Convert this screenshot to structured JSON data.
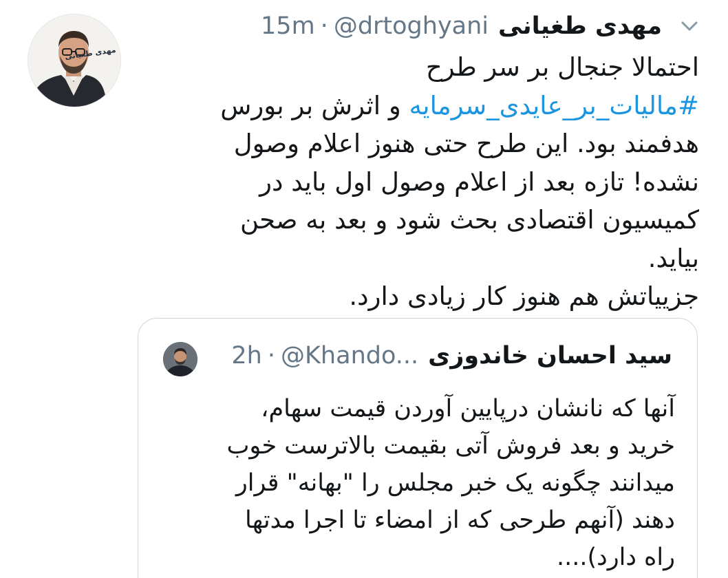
{
  "tweet": {
    "author": {
      "display_name": "مهدی طغیانی",
      "handle": "@drtoghyani",
      "separator": "·",
      "time": "15m",
      "avatar_logo_text": "مهدی طغیانی"
    },
    "menu_icon": "chevron-down-icon",
    "text_lines": [
      "احتمالا جنجال بر سر طرح",
      "#مالیات_بر_عایدی_سرمایه",
      " و اثرش بر بورس",
      "هدفمند بود. این طرح حتی هنوز اعلام وصول",
      "نشده! تازه بعد از اعلام وصول اول باید در",
      "کمیسیون اقتصادی بحث شود و بعد به صحن",
      "بیاید.",
      "جزییاتش هم هنوز کار زیادی دارد."
    ],
    "colors": {
      "hashtag": "#1b95e0",
      "secondary_text": "#657786",
      "border": "#ccd6dd"
    }
  },
  "quoted_tweet": {
    "author": {
      "display_name": "سید احسان خاندوزی",
      "handle": "@Khando...",
      "separator": "·",
      "time": "2h"
    },
    "text_lines": [
      "آنها که نانشان درپایین آوردن قیمت سهام،",
      "خرید و بعد فروش آتی بقیمت بالاترست خوب",
      "میدانند چگونه یک خبر مجلس را \"بهانه\" قرار",
      "دهند (آنهم طرحی که از امضاء تا اجرا مدتها",
      "راه دارد)...."
    ]
  }
}
